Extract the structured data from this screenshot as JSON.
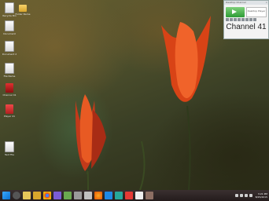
{
  "desktop": {
    "icons": [
      {
        "label": "Recycle Bin",
        "kind": "bin"
      },
      {
        "label": "Folder Name",
        "kind": "folder"
      },
      {
        "label": "Document",
        "kind": "doc"
      },
      {
        "label": "Document 2",
        "kind": "doc"
      },
      {
        "label": "File Name",
        "kind": "doc"
      },
      {
        "label": "Channel 41",
        "kind": "redapp"
      },
      {
        "label": "Player 41",
        "kind": "redapp"
      },
      {
        "label": "Text File",
        "kind": "doc"
      }
    ]
  },
  "widget": {
    "title": "Desktop Channel",
    "close": "×",
    "box_text": "Desktop Player",
    "channel": "Channel 41"
  },
  "taskbar": {
    "apps": [
      "start-icon",
      "search-icon",
      "file-explorer-icon",
      "folder-icon",
      "chrome-icon",
      "media-icon",
      "store-icon",
      "app-icon",
      "settings-icon",
      "firefox-icon",
      "edge-icon",
      "network-icon",
      "s-app-icon",
      "document-icon",
      "camera-icon"
    ],
    "clock_time": "3:21 PM",
    "clock_date": "8/25/2015"
  }
}
